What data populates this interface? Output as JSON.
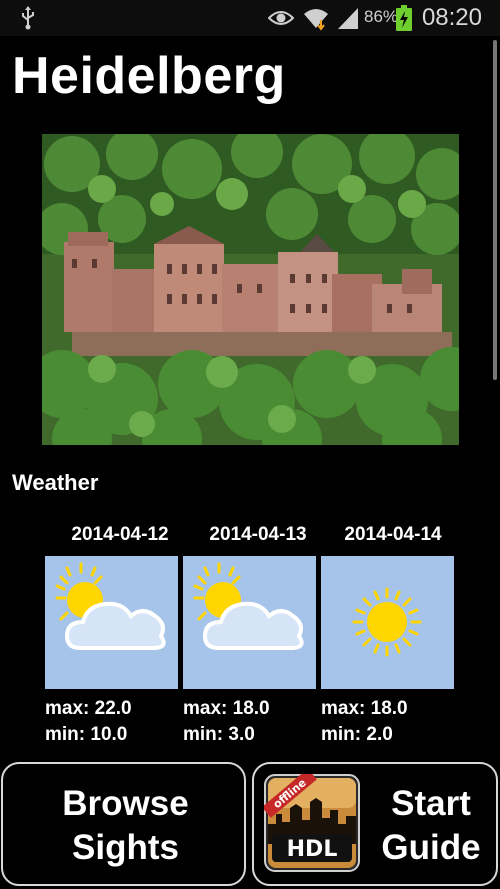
{
  "status_bar": {
    "battery_percent": "86%",
    "time": "08:20",
    "icons": [
      "usb-icon",
      "eye-icon",
      "wifi-icon",
      "signal-icon",
      "battery-charging-icon"
    ]
  },
  "page": {
    "title": "Heidelberg"
  },
  "image": {
    "subject": "castle-photo"
  },
  "weather": {
    "heading": "Weather",
    "days": [
      {
        "date": "2014-04-12",
        "icon": "partly-cloudy-icon",
        "max": "max: 22.0",
        "min": "min: 10.0"
      },
      {
        "date": "2014-04-13",
        "icon": "partly-cloudy-icon",
        "max": "max: 18.0",
        "min": "min: 3.0"
      },
      {
        "date": "2014-04-14",
        "icon": "sunny-icon",
        "max": "max: 18.0",
        "min": "min: 2.0"
      }
    ]
  },
  "buttons": {
    "browse": {
      "line1": "Browse",
      "line2": "Sights"
    },
    "guide": {
      "line1": "Start",
      "line2": "Guide"
    },
    "logo": {
      "ribbon": "offline",
      "text": "HDL"
    }
  },
  "colors": {
    "tile_background": "#a6c4ea",
    "sun": "#ffd600",
    "cloud": "#d6e4f7",
    "battery": "#6fcf2e"
  }
}
